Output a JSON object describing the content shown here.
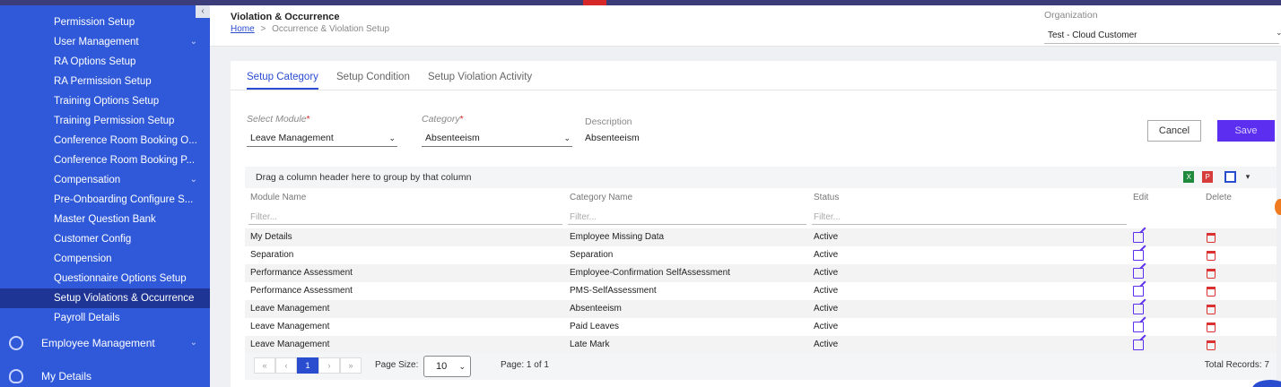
{
  "sidebar": {
    "collapse": "‹",
    "items": [
      {
        "label": "Permission Setup",
        "chev": ""
      },
      {
        "label": "User Management",
        "chev": "⌄"
      },
      {
        "label": "RA Options Setup",
        "chev": ""
      },
      {
        "label": "RA Permission Setup",
        "chev": ""
      },
      {
        "label": "Training Options Setup",
        "chev": ""
      },
      {
        "label": "Training Permission Setup",
        "chev": ""
      },
      {
        "label": "Conference Room Booking O...",
        "chev": ""
      },
      {
        "label": "Conference Room Booking P...",
        "chev": ""
      },
      {
        "label": "Compensation",
        "chev": "⌄"
      },
      {
        "label": "Pre-Onboarding Configure S...",
        "chev": ""
      },
      {
        "label": "Master Question Bank",
        "chev": ""
      },
      {
        "label": "Customer Config",
        "chev": ""
      },
      {
        "label": "Compension",
        "chev": ""
      },
      {
        "label": "Questionnaire Options Setup",
        "chev": ""
      },
      {
        "label": "Setup Violations & Occurrence",
        "chev": ""
      },
      {
        "label": "Payroll Details",
        "chev": ""
      }
    ],
    "employee_management": "Employee Management",
    "employee_management_chev": "⌄",
    "my_details": "My Details"
  },
  "header": {
    "title": "Violation & Occurrence",
    "breadcrumb_home": "Home",
    "breadcrumb_sep": ">",
    "breadcrumb_current": "Occurrence & Violation Setup",
    "org_label": "Organization",
    "org_value": "Test - Cloud Customer",
    "org_chev": "⌄"
  },
  "tabs": [
    "Setup Category",
    "Setup Condition",
    "Setup Violation Activity"
  ],
  "form": {
    "module_label": "Select Module",
    "module_value": "Leave Management",
    "category_label": "Category",
    "category_value": "Absenteeism",
    "required_mark": "*",
    "select_chev": "⌄",
    "description_label": "Description",
    "description_value": "Absenteeism",
    "cancel": "Cancel",
    "save": "Save"
  },
  "grid": {
    "group_hint": "Drag a column header here to group by that column",
    "toolbar_icons": {
      "excel": "X",
      "pdf": "P",
      "cols": "",
      "caret": "▾"
    },
    "columns": {
      "module": "Module Name",
      "category": "Category Name",
      "status": "Status",
      "edit": "Edit",
      "delete": "Delete"
    },
    "filter_placeholder": "Filter...",
    "rows": [
      {
        "module": "My Details",
        "category": "Employee Missing Data",
        "status": "Active"
      },
      {
        "module": "Separation",
        "category": "Separation",
        "status": "Active"
      },
      {
        "module": "Performance Assessment",
        "category": "Employee-Confirmation SelfAssessment",
        "status": "Active"
      },
      {
        "module": "Performance Assessment",
        "category": "PMS-SelfAssessment",
        "status": "Active"
      },
      {
        "module": "Leave Management",
        "category": "Absenteeism",
        "status": "Active"
      },
      {
        "module": "Leave Management",
        "category": "Paid Leaves",
        "status": "Active"
      },
      {
        "module": "Leave Management",
        "category": "Late Mark",
        "status": "Active"
      }
    ]
  },
  "pager": {
    "first": "«",
    "prev": "‹",
    "current_page": "1",
    "next": "›",
    "last": "»",
    "page_size_label": "Page Size:",
    "page_size": "10",
    "page_size_chev": "⌄",
    "page_info": "Page: 1 of 1",
    "total_records": "Total Records: 7"
  }
}
